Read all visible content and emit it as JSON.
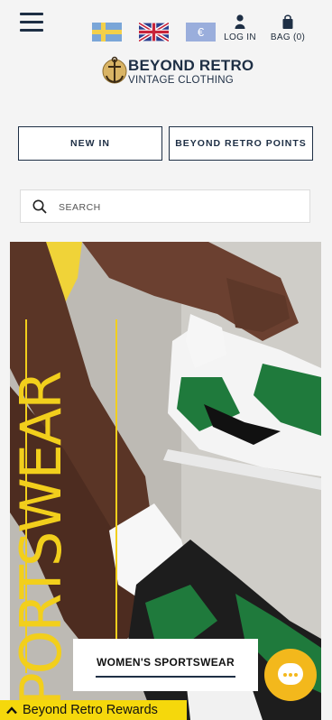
{
  "header": {
    "login_label": "LOG IN",
    "bag_label": "BAG (0)",
    "currency_symbol": "€",
    "icons": [
      "menu-icon",
      "sweden-flag",
      "uk-flag",
      "euro-currency",
      "user-icon",
      "bag-icon"
    ]
  },
  "logo": {
    "line1": "BEYOND RETRO",
    "line2": "VINTAGE CLOTHING"
  },
  "buttons": {
    "new_in": "NEW IN",
    "points": "BEYOND RETRO POINTS"
  },
  "search": {
    "placeholder": "SEARCH"
  },
  "hero": {
    "title": "SPORTSWEAR",
    "category_button": "WOMEN'S SPORTSWEAR",
    "accent_color": "#f2cf1c"
  },
  "rewards": {
    "label": "Beyond Retro Rewards",
    "color": "#f5d80c"
  },
  "chat": {
    "color": "#f3b81c"
  }
}
